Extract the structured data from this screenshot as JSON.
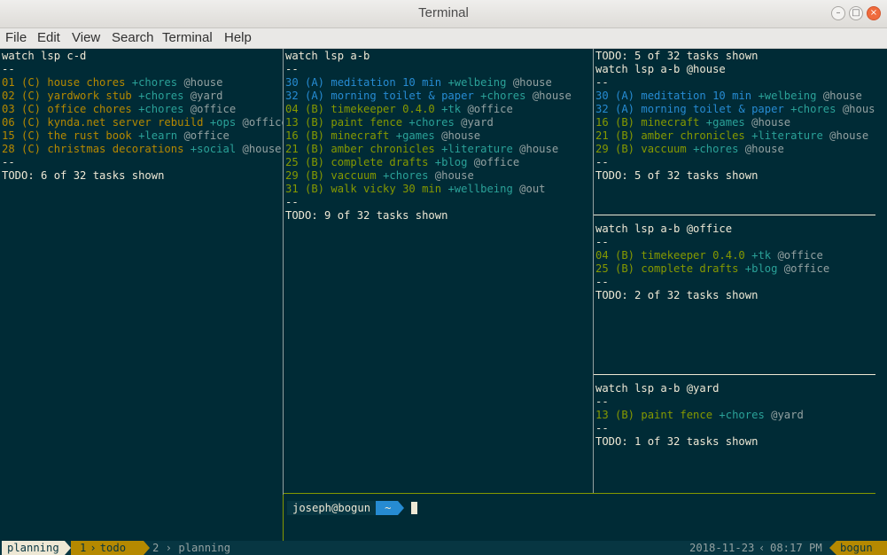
{
  "window": {
    "title": "Terminal",
    "minimize_glyph": "–",
    "maximize_glyph": "□",
    "close_glyph": "×"
  },
  "menu": [
    "File",
    "Edit",
    "View",
    "Search",
    "Terminal",
    "Help"
  ],
  "panes": {
    "cd": {
      "command": "watch lsp c-d",
      "rule": "--",
      "tasks": [
        {
          "id": "01",
          "pri": "(C)",
          "text": "house chores",
          "project": "+chores",
          "context": "@house"
        },
        {
          "id": "02",
          "pri": "(C)",
          "text": "yardwork stub",
          "project": "+chores",
          "context": "@yard"
        },
        {
          "id": "03",
          "pri": "(C)",
          "text": "office chores",
          "project": "+chores",
          "context": "@office"
        },
        {
          "id": "06",
          "pri": "(C)",
          "text": "kynda.net server rebuild",
          "project": "+ops",
          "context": "@office"
        },
        {
          "id": "15",
          "pri": "(C)",
          "text": "the rust book",
          "project": "+learn",
          "context": "@office"
        },
        {
          "id": "28",
          "pri": "(C)",
          "text": "christmas decorations",
          "project": "+social",
          "context": "@house"
        }
      ],
      "footer": "TODO: 6 of 32 tasks shown"
    },
    "ab": {
      "command": "watch lsp a-b",
      "rule": "--",
      "tasks": [
        {
          "id": "30",
          "pri": "(A)",
          "text": "meditation 10 min",
          "project": "+welbeing",
          "context": "@house"
        },
        {
          "id": "32",
          "pri": "(A)",
          "text": "morning toilet & paper",
          "project": "+chores",
          "context": "@house"
        },
        {
          "id": "04",
          "pri": "(B)",
          "text": "timekeeper 0.4.0",
          "project": "+tk",
          "context": "@office"
        },
        {
          "id": "13",
          "pri": "(B)",
          "text": "paint fence",
          "project": "+chores",
          "context": "@yard"
        },
        {
          "id": "16",
          "pri": "(B)",
          "text": "minecraft",
          "project": "+games",
          "context": "@house"
        },
        {
          "id": "21",
          "pri": "(B)",
          "text": "amber chronicles",
          "project": "+literature",
          "context": "@house"
        },
        {
          "id": "25",
          "pri": "(B)",
          "text": "complete drafts",
          "project": "+blog",
          "context": "@office"
        },
        {
          "id": "29",
          "pri": "(B)",
          "text": "vaccuum",
          "project": "+chores",
          "context": "@house"
        },
        {
          "id": "31",
          "pri": "(B)",
          "text": "walk vicky 30 min",
          "project": "+wellbeing",
          "context": "@out"
        }
      ],
      "footer": "TODO: 9 of 32 tasks shown"
    },
    "house": {
      "header": "TODO: 5 of 32 tasks shown",
      "command": "watch lsp a-b @house",
      "rule": "--",
      "tasks": [
        {
          "id": "30",
          "pri": "(A)",
          "text": "meditation 10 min",
          "project": "+welbeing",
          "context": "@house"
        },
        {
          "id": "32",
          "pri": "(A)",
          "text": "morning toilet & paper",
          "project": "+chores",
          "context": "@house"
        },
        {
          "id": "16",
          "pri": "(B)",
          "text": "minecraft",
          "project": "+games",
          "context": "@house"
        },
        {
          "id": "21",
          "pri": "(B)",
          "text": "amber chronicles",
          "project": "+literature",
          "context": "@house"
        },
        {
          "id": "29",
          "pri": "(B)",
          "text": "vaccuum",
          "project": "+chores",
          "context": "@house"
        }
      ],
      "footer": "TODO: 5 of 32 tasks shown"
    },
    "office": {
      "command": "watch lsp a-b @office",
      "rule": "--",
      "tasks": [
        {
          "id": "04",
          "pri": "(B)",
          "text": "timekeeper 0.4.0",
          "project": "+tk",
          "context": "@office"
        },
        {
          "id": "25",
          "pri": "(B)",
          "text": "complete drafts",
          "project": "+blog",
          "context": "@office"
        }
      ],
      "footer": "TODO: 2 of 32 tasks shown"
    },
    "yard": {
      "command": "watch lsp a-b @yard",
      "rule": "--",
      "tasks": [
        {
          "id": "13",
          "pri": "(B)",
          "text": "paint fence",
          "project": "+chores",
          "context": "@yard"
        }
      ],
      "footer": "TODO: 1 of 32 tasks shown"
    }
  },
  "prompt": {
    "user_host": "joseph@bogun",
    "dir": "~"
  },
  "status": {
    "session": "planning",
    "win1_index": "1",
    "win1_name": "todo",
    "win2_index": "2",
    "win2_name": "planning",
    "date": "2018-11-23",
    "time": "08:17 PM",
    "host": "bogun"
  },
  "colors": {
    "priority_a": "#268bd2",
    "priority_b": "#859900",
    "priority_c": "#b58900",
    "project": "#2aa198",
    "context": "#93a1a1",
    "background": "#002b36"
  }
}
